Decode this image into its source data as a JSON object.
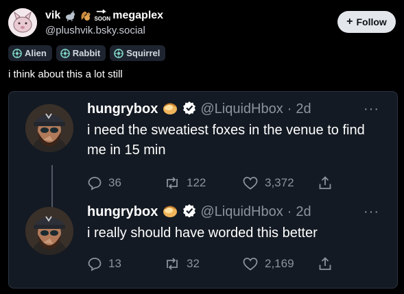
{
  "post": {
    "display_name": "vik",
    "emoji_soon_label": "SOON",
    "display_name_suffix": "megaplex",
    "handle": "@plushvik.bsky.social",
    "follow_label": "Follow",
    "labels": [
      "Alien",
      "Rabbit",
      "Squirrel"
    ],
    "text": "i think about this a lot still"
  },
  "tweets": [
    {
      "name": "hungrybox",
      "handle": "@LiquidHbox",
      "dot": "·",
      "time": "2d",
      "more": "···",
      "text": "i need the sweatiest foxes in the venue to find me in 15 min",
      "replies": "36",
      "retweets": "122",
      "likes": "3,372"
    },
    {
      "name": "hungrybox",
      "handle": "@LiquidHbox",
      "dot": "·",
      "time": "2d",
      "more": "···",
      "text": "i really should have worded this better",
      "replies": "13",
      "retweets": "32",
      "likes": "2,169"
    }
  ],
  "colors": {
    "background": "#000000",
    "card_background": "#141a23",
    "muted_text": "#8b949e",
    "verified": "#ffffff"
  }
}
